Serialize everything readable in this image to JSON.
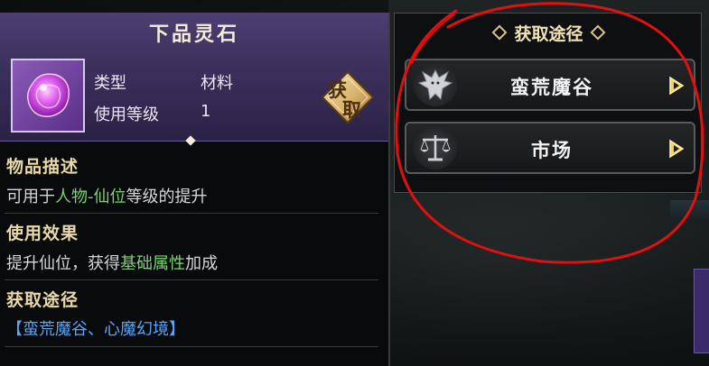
{
  "item": {
    "title": "下品灵石",
    "type_label": "类型",
    "type_value": "材料",
    "level_label": "使用等级",
    "level_value": "1",
    "acquire_char1": "获",
    "acquire_char2": "取"
  },
  "description": {
    "title": "物品描述",
    "prefix": "可用于",
    "highlight": "人物-仙位",
    "suffix": "等级的提升"
  },
  "effect": {
    "title": "使用效果",
    "prefix": "提升仙位，获得",
    "highlight": "基础属性",
    "suffix": "加成"
  },
  "acquisition": {
    "title": "获取途径",
    "text": "【蛮荒魔谷、心魔幻境】"
  },
  "sources_panel": {
    "title": "获取途径",
    "items": [
      {
        "label": "蛮荒魔谷",
        "icon": "dragon-icon"
      },
      {
        "label": "市场",
        "icon": "scales-icon"
      }
    ]
  },
  "colors": {
    "header_purple": "#3b2f5c",
    "section_title_gold": "#e9d9a8",
    "highlight_green": "#7fd077",
    "highlight_blue": "#56a6ff",
    "annotation_red": "#e01010"
  }
}
